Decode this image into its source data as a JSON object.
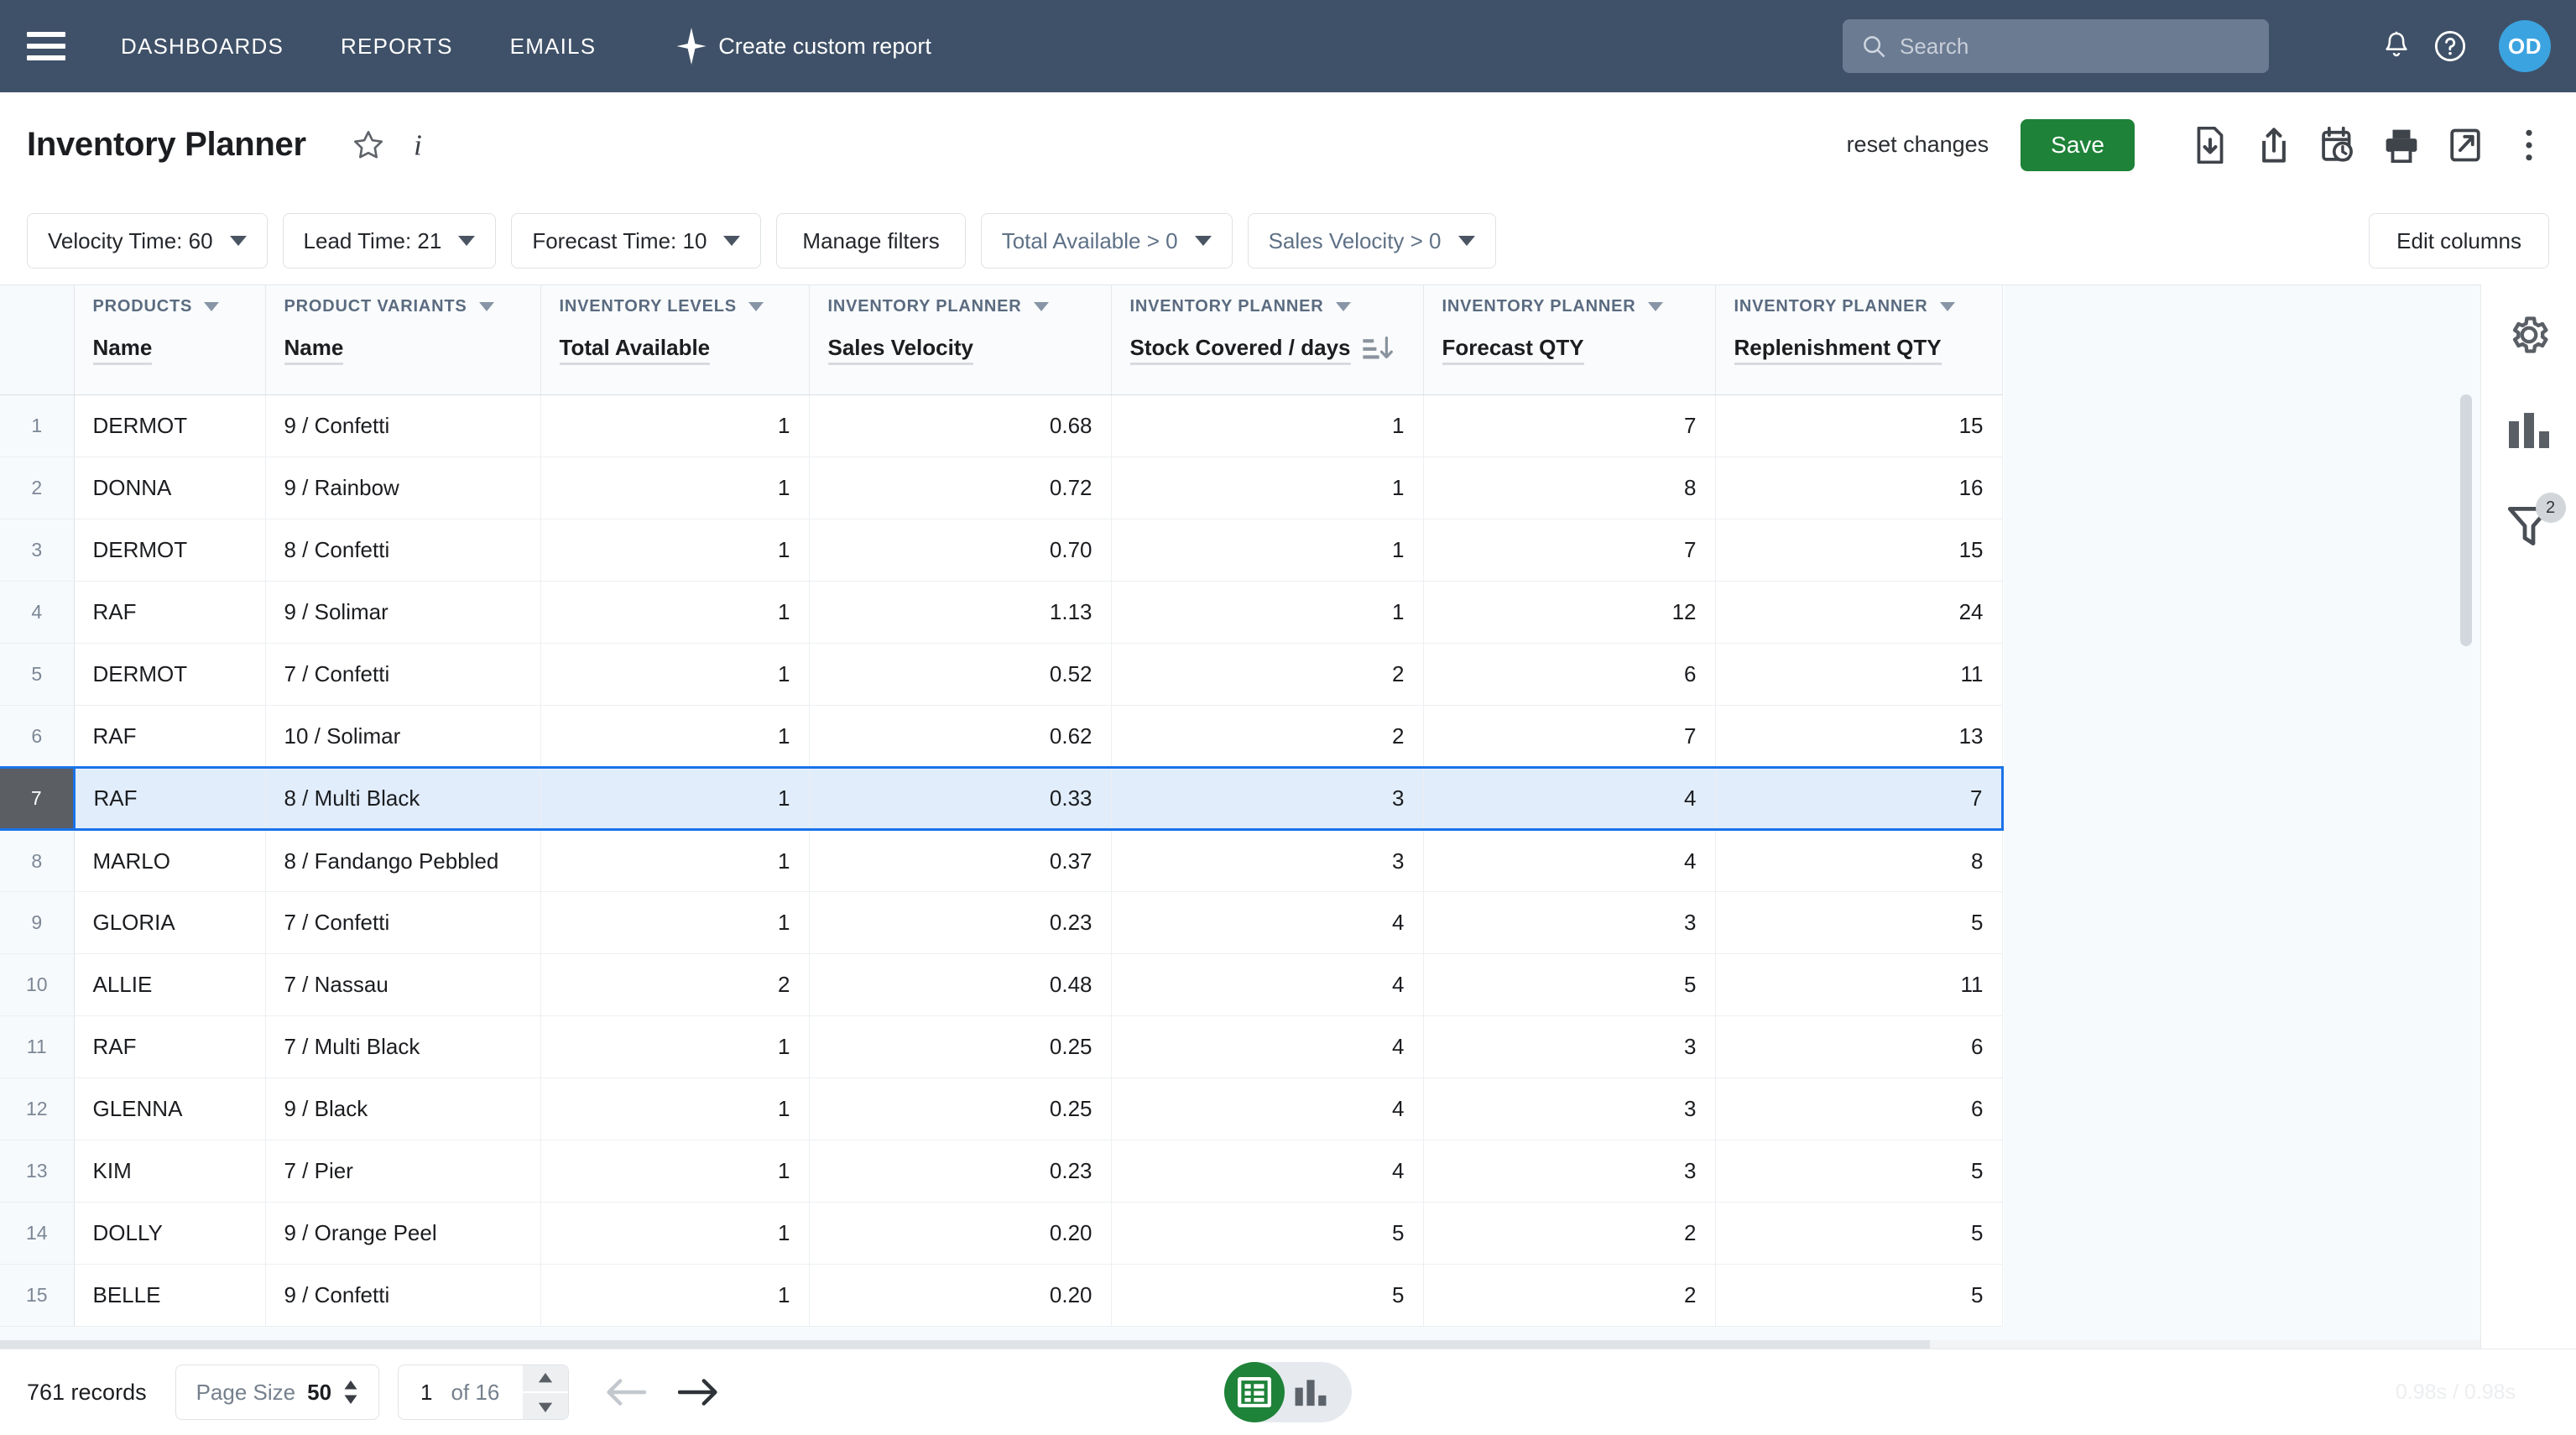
{
  "topnav": {
    "menu_icon": "hamburger-icon",
    "links": [
      "DASHBOARDS",
      "REPORTS",
      "EMAILS"
    ],
    "create_report_label": "Create custom report",
    "search_placeholder": "Search",
    "search_value": "",
    "notifications_icon": "bell-icon",
    "help_icon": "help-circle-icon",
    "avatar_initials": "OD",
    "avatar_color": "#3ba3e0",
    "bg_color": "#3f5168"
  },
  "titlebar": {
    "title": "Inventory Planner",
    "favorite_icon": "star-icon",
    "info_icon": "info-icon",
    "reset_label": "reset changes",
    "save_label": "Save",
    "save_color": "#1e8238",
    "actions": [
      "download-icon",
      "share-icon",
      "schedule-clock-icon",
      "print-icon",
      "open-external-icon",
      "more-vertical-icon"
    ]
  },
  "filterbar": {
    "chips": [
      {
        "label": "Velocity Time: 60",
        "muted": false,
        "caret": true
      },
      {
        "label": "Lead Time: 21",
        "muted": false,
        "caret": true
      },
      {
        "label": "Forecast Time: 10",
        "muted": false,
        "caret": true
      },
      {
        "label": "Manage filters",
        "muted": false,
        "caret": false
      },
      {
        "label": "Total Available > 0",
        "muted": true,
        "caret": true
      },
      {
        "label": "Sales Velocity > 0",
        "muted": true,
        "caret": true
      }
    ],
    "edit_columns_label": "Edit columns"
  },
  "rail": {
    "items": [
      {
        "icon": "gear-icon",
        "badge": ""
      },
      {
        "icon": "bar-chart-icon",
        "badge": ""
      },
      {
        "icon": "filter-funnel-icon",
        "badge": "2"
      }
    ]
  },
  "table": {
    "columns": [
      {
        "group": "PRODUCTS",
        "field": "Name",
        "align": "left",
        "sorted": false
      },
      {
        "group": "PRODUCT VARIANTS",
        "field": "Name",
        "align": "left",
        "sorted": false
      },
      {
        "group": "INVENTORY LEVELS",
        "field": "Total Available",
        "align": "right",
        "sorted": false
      },
      {
        "group": "INVENTORY PLANNER",
        "field": "Sales Velocity",
        "align": "right",
        "sorted": false
      },
      {
        "group": "INVENTORY PLANNER",
        "field": "Stock Covered / days",
        "align": "right",
        "sorted": true,
        "sort_dir": "desc"
      },
      {
        "group": "INVENTORY PLANNER",
        "field": "Forecast QTY",
        "align": "right",
        "sorted": false
      },
      {
        "group": "INVENTORY PLANNER",
        "field": "Replenishment QTY",
        "align": "right",
        "sorted": false
      }
    ],
    "selected_row_index": 7,
    "rows": [
      {
        "n": "1",
        "product": "DERMOT",
        "variant": "9 / Confetti",
        "total": "1",
        "velocity": "0.68",
        "stock": "1",
        "forecast": "7",
        "replenish": "15"
      },
      {
        "n": "2",
        "product": "DONNA",
        "variant": "9 / Rainbow",
        "total": "1",
        "velocity": "0.72",
        "stock": "1",
        "forecast": "8",
        "replenish": "16"
      },
      {
        "n": "3",
        "product": "DERMOT",
        "variant": "8 / Confetti",
        "total": "1",
        "velocity": "0.70",
        "stock": "1",
        "forecast": "7",
        "replenish": "15"
      },
      {
        "n": "4",
        "product": "RAF",
        "variant": "9 / Solimar",
        "total": "1",
        "velocity": "1.13",
        "stock": "1",
        "forecast": "12",
        "replenish": "24"
      },
      {
        "n": "5",
        "product": "DERMOT",
        "variant": "7 / Confetti",
        "total": "1",
        "velocity": "0.52",
        "stock": "2",
        "forecast": "6",
        "replenish": "11"
      },
      {
        "n": "6",
        "product": "RAF",
        "variant": "10 / Solimar",
        "total": "1",
        "velocity": "0.62",
        "stock": "2",
        "forecast": "7",
        "replenish": "13"
      },
      {
        "n": "7",
        "product": "RAF",
        "variant": "8 / Multi Black",
        "total": "1",
        "velocity": "0.33",
        "stock": "3",
        "forecast": "4",
        "replenish": "7"
      },
      {
        "n": "8",
        "product": "MARLO",
        "variant": "8 / Fandango Pebbled",
        "total": "1",
        "velocity": "0.37",
        "stock": "3",
        "forecast": "4",
        "replenish": "8"
      },
      {
        "n": "9",
        "product": "GLORIA",
        "variant": "7 / Confetti",
        "total": "1",
        "velocity": "0.23",
        "stock": "4",
        "forecast": "3",
        "replenish": "5"
      },
      {
        "n": "10",
        "product": "ALLIE",
        "variant": "7 / Nassau",
        "total": "2",
        "velocity": "0.48",
        "stock": "4",
        "forecast": "5",
        "replenish": "11"
      },
      {
        "n": "11",
        "product": "RAF",
        "variant": "7 / Multi Black",
        "total": "1",
        "velocity": "0.25",
        "stock": "4",
        "forecast": "3",
        "replenish": "6"
      },
      {
        "n": "12",
        "product": "GLENNA",
        "variant": "9 / Black",
        "total": "1",
        "velocity": "0.25",
        "stock": "4",
        "forecast": "3",
        "replenish": "6"
      },
      {
        "n": "13",
        "product": "KIM",
        "variant": "7 / Pier",
        "total": "1",
        "velocity": "0.23",
        "stock": "4",
        "forecast": "3",
        "replenish": "5"
      },
      {
        "n": "14",
        "product": "DOLLY",
        "variant": "9 / Orange Peel",
        "total": "1",
        "velocity": "0.20",
        "stock": "5",
        "forecast": "2",
        "replenish": "5"
      },
      {
        "n": "15",
        "product": "BELLE",
        "variant": "9 / Confetti",
        "total": "1",
        "velocity": "0.20",
        "stock": "5",
        "forecast": "2",
        "replenish": "5"
      }
    ]
  },
  "footer": {
    "records_label": "761 records",
    "page_size_label": "Page Size",
    "page_size_value": "50",
    "page_number": "1",
    "page_of": "of 16",
    "prev_icon": "arrow-left-icon",
    "next_icon": "arrow-right-icon",
    "view_table_icon": "table-view-icon",
    "view_chart_icon": "chart-view-icon",
    "timing": "0.98s / 0.98s"
  }
}
